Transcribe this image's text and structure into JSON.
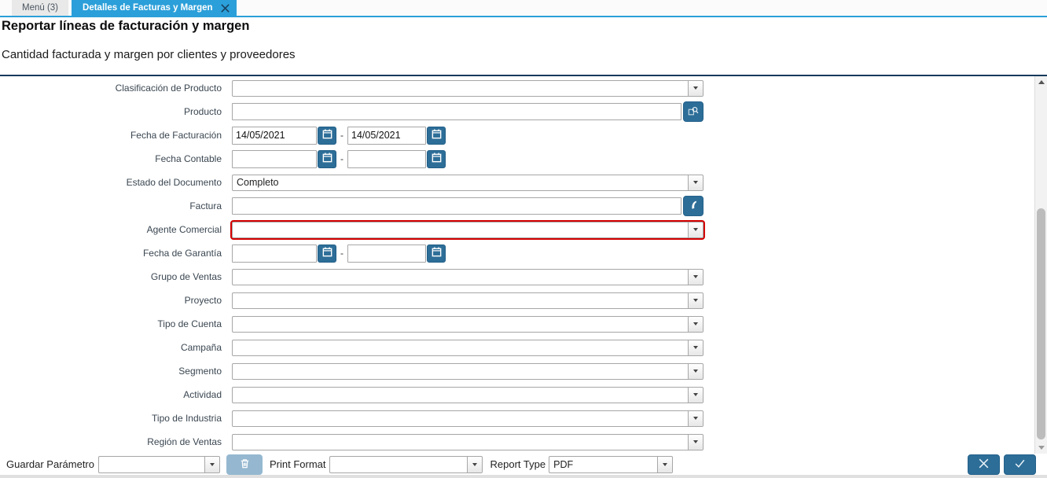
{
  "tabs": [
    {
      "label": "Menú (3)",
      "active": false
    },
    {
      "label": "Detalles de Facturas y Margen",
      "active": true
    }
  ],
  "header": {
    "title": "Reportar líneas de facturación y margen",
    "subtitle": "Cantidad facturada y margen por clientes y proveedores"
  },
  "form": {
    "date_separator": "-",
    "rows": [
      {
        "id": "clasificacion-de-producto",
        "label": "Clasificación de Producto",
        "type": "combo",
        "value": ""
      },
      {
        "id": "producto",
        "label": "Producto",
        "type": "lookup",
        "value": "",
        "icon": "product-search-icon"
      },
      {
        "id": "fecha-de-facturacion",
        "label": "Fecha de Facturación",
        "type": "daterange",
        "from": "14/05/2021",
        "to": "14/05/2021"
      },
      {
        "id": "fecha-contable",
        "label": "Fecha Contable",
        "type": "daterange",
        "from": "",
        "to": ""
      },
      {
        "id": "estado-del-documento",
        "label": "Estado del Documento",
        "type": "combo",
        "value": "Completo"
      },
      {
        "id": "factura",
        "label": "Factura",
        "type": "lookup",
        "value": "",
        "icon": "record-search-icon"
      },
      {
        "id": "agente-comercial",
        "label": "Agente Comercial",
        "type": "combo",
        "value": "",
        "required": true
      },
      {
        "id": "fecha-de-garantia",
        "label": "Fecha de Garantía",
        "type": "daterange",
        "from": "",
        "to": ""
      },
      {
        "id": "grupo-de-ventas",
        "label": "Grupo de Ventas",
        "type": "combo",
        "value": ""
      },
      {
        "id": "proyecto",
        "label": "Proyecto",
        "type": "combo",
        "value": ""
      },
      {
        "id": "tipo-de-cuenta",
        "label": "Tipo de Cuenta",
        "type": "combo",
        "value": ""
      },
      {
        "id": "campana",
        "label": "Campaña",
        "type": "combo",
        "value": ""
      },
      {
        "id": "segmento",
        "label": "Segmento",
        "type": "combo",
        "value": ""
      },
      {
        "id": "actividad",
        "label": "Actividad",
        "type": "combo",
        "value": ""
      },
      {
        "id": "tipo-de-industria",
        "label": "Tipo de Industria",
        "type": "combo",
        "value": ""
      },
      {
        "id": "region-de-ventas",
        "label": "Región de Ventas",
        "type": "combo",
        "value": ""
      }
    ]
  },
  "footer": {
    "save_label": "Guardar Parámetro",
    "save_value": "",
    "print_format_label": "Print Format",
    "print_format_value": "",
    "report_type_label": "Report Type",
    "report_type_value": "PDF"
  },
  "icons": {
    "tab_close": "close-icon",
    "calendar": "calendar-icon",
    "product_lookup": "product-search-icon",
    "invoice_lookup": "record-search-icon",
    "delete": "trash-icon",
    "cancel": "close-icon",
    "confirm": "check-icon",
    "combo": "chevron-down-icon"
  },
  "colors": {
    "accent_blue": "#2b9fd9",
    "divider_navy": "#17395c",
    "button_blue": "#2d6e98",
    "disabled_button_blue": "#95b8d0",
    "required_red": "#d40000",
    "field_border": "#a6a6a6"
  }
}
